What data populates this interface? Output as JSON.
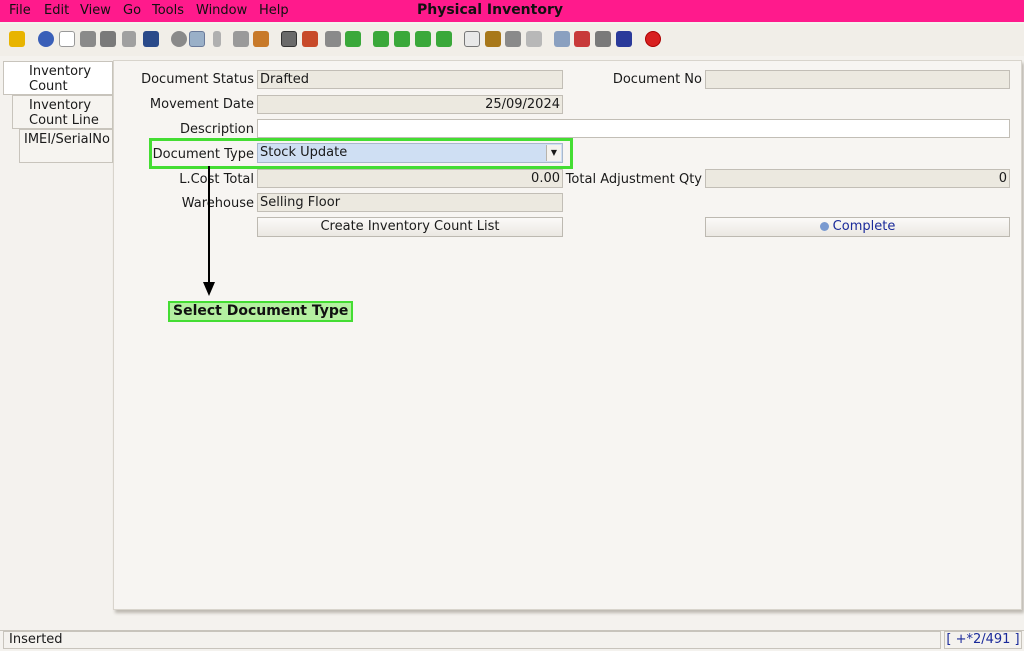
{
  "app": {
    "title": "Physical Inventory"
  },
  "menu": [
    "File",
    "Edit",
    "View",
    "Go",
    "Tools",
    "Window",
    "Help"
  ],
  "toolbar": {
    "icons": [
      "undo-icon",
      "help-icon",
      "new-icon",
      "copy-icon",
      "delete-icon",
      "delete-selection-icon",
      "save-icon",
      "refresh-icon",
      "find-icon",
      "attachment-icon",
      "chat-icon",
      "history-icon",
      "home-icon",
      "parent-icon",
      "back-icon",
      "forward-icon",
      "first-record-icon",
      "previous-record-icon",
      "next-record-icon",
      "last-record-icon",
      "report-icon",
      "archive-icon",
      "print-icon",
      "print-preview-icon",
      "zoom-across-icon",
      "workflow-icon",
      "request-icon",
      "product-info-icon",
      "close-icon"
    ]
  },
  "tabs": [
    {
      "line1": "Inventory",
      "line2": "Count"
    },
    {
      "line1": "Inventory",
      "line2": "Count Line"
    },
    {
      "line1": "IMEI/SerialNo",
      "line2": ""
    }
  ],
  "form": {
    "document_status_label": "Document Status",
    "document_status_value": "Drafted",
    "document_no_label": "Document No",
    "document_no_value": "",
    "movement_date_label": "Movement Date",
    "movement_date_value": "25/09/2024",
    "description_label": "Description",
    "description_value": "",
    "document_type_label": "Document Type",
    "document_type_value": "Stock Update",
    "lcost_total_label": "L.Cost Total",
    "lcost_total_value": "0.00",
    "total_adjustment_qty_label": "Total Adjustment Qty",
    "total_adjustment_qty_value": "0",
    "warehouse_label": "Warehouse",
    "warehouse_value": "Selling Floor",
    "create_list_button": "Create Inventory Count List",
    "complete_button": "Complete"
  },
  "annotation": {
    "callout": "Select Document Type",
    "highlight_color": "#44dd33"
  },
  "status": {
    "text": "Inserted",
    "record_info": "[ +*2/491 ]"
  },
  "colors": {
    "title_bar": "#ff1a8c",
    "highlight": "#44dd33",
    "complete_text": "#1a2a9a"
  }
}
